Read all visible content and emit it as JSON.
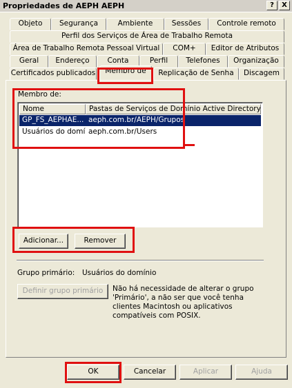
{
  "window": {
    "title": "Propriedades de AEPH AEPH",
    "help_glyph": "?",
    "close_glyph": "X"
  },
  "tabs": {
    "row1": [
      "Objeto",
      "Segurança",
      "Ambiente",
      "Sessões",
      "Controle remoto"
    ],
    "row2": [
      "Perfil dos Serviços de Área de Trabalho Remota"
    ],
    "row3": [
      "Área de Trabalho Remota Pessoal Virtual",
      "COM+",
      "Editor de Atributos"
    ],
    "row4": [
      "Geral",
      "Endereço",
      "Conta",
      "Perfil",
      "Telefones",
      "Organização"
    ],
    "row5": [
      "Certificados publicados",
      "Membro de",
      "Replicação de Senha",
      "Discagem"
    ],
    "active": "Membro de"
  },
  "member_of": {
    "label": "Membro de:",
    "columns": [
      "Nome",
      "Pastas de Serviços de Domínio Active Directory"
    ],
    "rows": [
      {
        "name": "GP_FS_AEPHAE...",
        "folder": "aeph.com.br/AEPH/Grupos",
        "selected": true
      },
      {
        "name": "Usuários do domí...",
        "folder": "aeph.com.br/Users",
        "selected": false
      }
    ],
    "add_button": "Adicionar...",
    "remove_button": "Remover"
  },
  "primary_group": {
    "label": "Grupo primário:",
    "value": "Usuários do domínio",
    "set_button": "Definir grupo primário",
    "note": "Não há necessidade de alterar o grupo 'Primário', a não ser que você tenha clientes Macintosh ou aplicativos compatíveis com POSIX."
  },
  "footer": {
    "ok": "OK",
    "cancel": "Cancelar",
    "apply": "Aplicar",
    "help": "Ajuda"
  },
  "colors": {
    "highlight_box": "#e01010",
    "selection": "#0a246a",
    "face": "#ece9d8"
  }
}
